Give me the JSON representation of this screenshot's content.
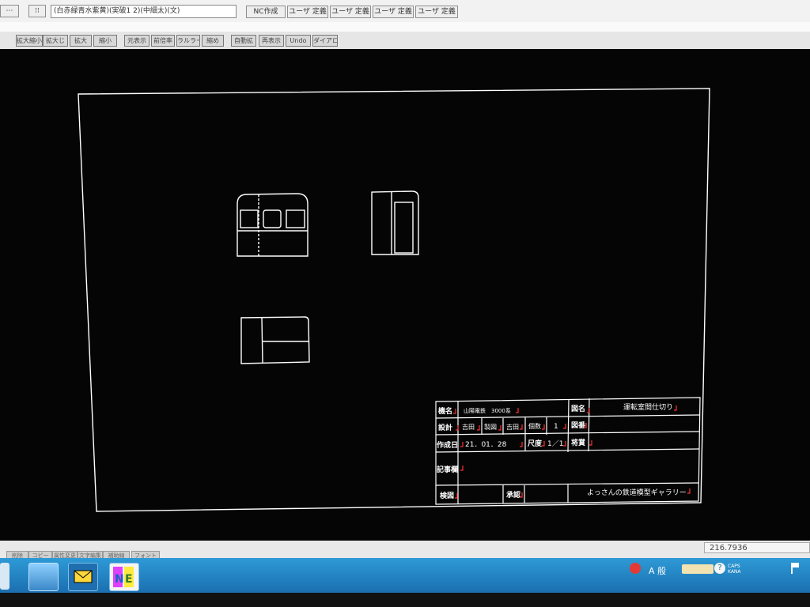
{
  "toolbar": {
    "color_layer_combo": "(白赤緑青水紫黄)(実破1 2)(中細太)(文)",
    "nc_create": "NC作成",
    "user_def_1": "ユーザ 定義",
    "user_def_2": "ユーザ 定義",
    "user_def_3": "ユーザ 定義",
    "user_def_4": "ユーザ 定義"
  },
  "toolbar2": {
    "items": [
      "拡大縮小",
      "拡大じ",
      "拡大",
      "縮小",
      "元表示",
      "前倍率",
      "ラルラー",
      "縮め",
      "自動拡",
      "再表示",
      "Undo",
      "ダイアロ"
    ]
  },
  "title_block": {
    "label_kimei": "機名",
    "value_kimei": "山陽電鉄　3000系",
    "label_zumei": "図名",
    "value_zumei": "運転室間仕切り",
    "label_sekkei": "設計",
    "value_sekkei": "吉田",
    "label_seizu": "製図",
    "value_seizu": "吉田",
    "label_kosu": "個数",
    "value_kosu": "1",
    "label_zuban": "図番",
    "label_date": "作成日",
    "value_date": "21．01．28",
    "label_shakudo": "尺度",
    "value_shakudo": "1／1",
    "label_sanshou": "将賞",
    "label_kiji": "記事欄",
    "label_kento": "検図",
    "label_shonin": "承認",
    "value_gallery": "よっさんの鉄道模型ギャラリー"
  },
  "status": {
    "buttons": [
      "削除",
      "コピー",
      "属性変更",
      "文字編集",
      "補助線",
      "フォント"
    ],
    "coordinate": "216.7936"
  },
  "taskbar": {
    "ime_mode": "A 般",
    "caps": "CAPS",
    "kana": "KANA"
  },
  "colors": {
    "canvas": "#050505",
    "drawing_line": "#ffffff",
    "marker": "#ff3030",
    "taskbar": "#2283c6"
  }
}
